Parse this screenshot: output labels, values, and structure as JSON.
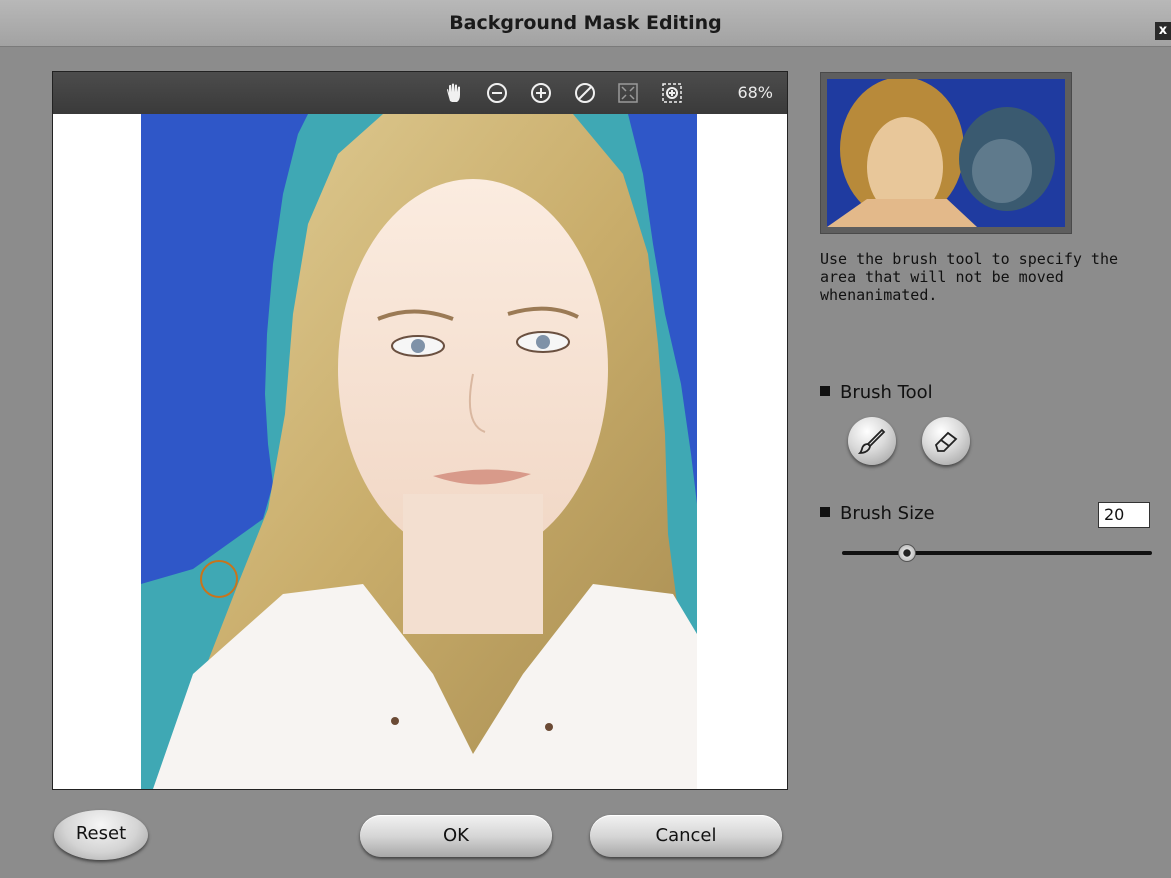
{
  "window": {
    "title": "Background Mask Editing",
    "close_label": "x"
  },
  "toolbar": {
    "icons": [
      "hand-icon",
      "zoom-out-icon",
      "zoom-in-icon",
      "clear-icon",
      "fit-icon",
      "actual-size-icon"
    ],
    "zoom": "68%"
  },
  "description": "Use the brush tool to specify the area that will not be moved whenanimated.",
  "brush_tool": {
    "label": "Brush Tool",
    "icons": [
      "brush-icon",
      "eraser-icon"
    ]
  },
  "brush_size": {
    "label": "Brush Size",
    "value": "20",
    "slider_fraction": 0.2
  },
  "buttons": {
    "reset": "Reset",
    "ok": "OK",
    "cancel": "Cancel"
  },
  "colors": {
    "mask": "#3fa8b4",
    "background": "#2f57c8",
    "cursor": "#c8741c"
  }
}
